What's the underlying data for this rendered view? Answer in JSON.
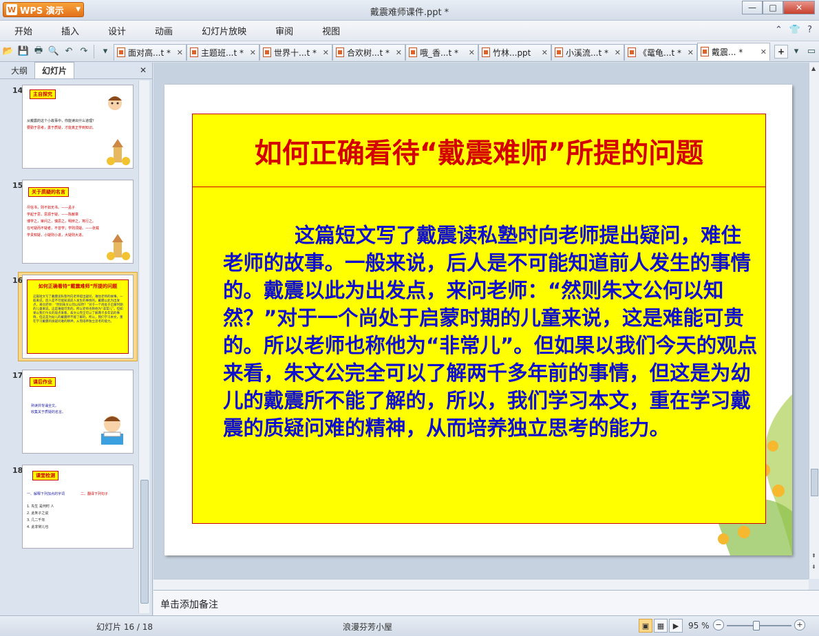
{
  "app": {
    "name": "WPS 演示",
    "logo": "W",
    "window_title": "戴震难师课件.ppt *"
  },
  "menu": [
    "开始",
    "插入",
    "设计",
    "动画",
    "幻灯片放映",
    "审阅",
    "视图"
  ],
  "doc_tabs": [
    {
      "label": "面对高...t *"
    },
    {
      "label": "主题班...t *"
    },
    {
      "label": "世界十...t *"
    },
    {
      "label": "合欢树...t *"
    },
    {
      "label": "哦_香...t *"
    },
    {
      "label": "竹林...ppt"
    },
    {
      "label": "小溪流...t *"
    },
    {
      "label": "《鼋龟...t *"
    },
    {
      "label": "戴震... *",
      "active": true
    }
  ],
  "left_panel": {
    "tabs": [
      "大纲",
      "幻灯片"
    ],
    "active_tab": "幻灯片",
    "thumbnails": [
      {
        "num": "14",
        "title": "主自探究",
        "lines": [
          "从戴震的这个小故事中，你能读出什么道理？",
          "要勤于思考，勇于质疑，才能真正学到知识。"
        ]
      },
      {
        "num": "15",
        "title": "关于质疑的名言",
        "lines": [
          "尽信书，则不如无书。——孟子",
          "学起于思，思源于疑。——陈献章",
          "博学之，审问之，慎思之，明辨之，笃行之。",
          "在可疑而不疑者，不曾学；学则须疑。——张载",
          "学贵知疑，小疑则小进，大疑则大进。"
        ]
      },
      {
        "num": "16",
        "title": "如何正确看待“戴震难师”所提的问题",
        "selected": true
      },
      {
        "num": "17",
        "title": "课后作业",
        "lines": [
          "熟读并背诵全文。",
          "收集关于质疑的名言。"
        ]
      },
      {
        "num": "18",
        "title": "课堂检测",
        "lines": [
          "一、解释下列加点的字词",
          "二、翻译下列句子",
          "1. 先生 是何时 人",
          "2. 此朱子之说",
          "3. 几二千年",
          "4. 此非常儿也"
        ]
      }
    ]
  },
  "slide": {
    "title": "如何正确看待“戴震难师”所提的问题",
    "body": "这篇短文写了戴震读私塾时向老师提出疑问，难住老师的故事。一般来说，后人是不可能知道前人发生的事情的。戴震以此为出发点，来问老师：“然则朱文公何以知然？”对于一个尚处于启蒙时期的儿童来说，这是难能可贵的。所以老师也称他为“非常儿”。但如果以我们今天的观点来看，朱文公完全可以了解两千多年前的事情，但这是为幼儿的戴震所不能了解的，所以，我们学习本文，重在学习戴震的质疑问难的精神，从而培养独立思考的能力。"
  },
  "notes_placeholder": "单击添加备注",
  "status": {
    "slide_counter": "幻灯片 16 / 18",
    "theme": "浪漫芬芳小屋",
    "zoom": "95 %"
  },
  "colors": {
    "title_red": "#d40000",
    "body_blue": "#1010cc",
    "box_yellow": "#ffff00",
    "wps_orange": "#e2701a"
  }
}
